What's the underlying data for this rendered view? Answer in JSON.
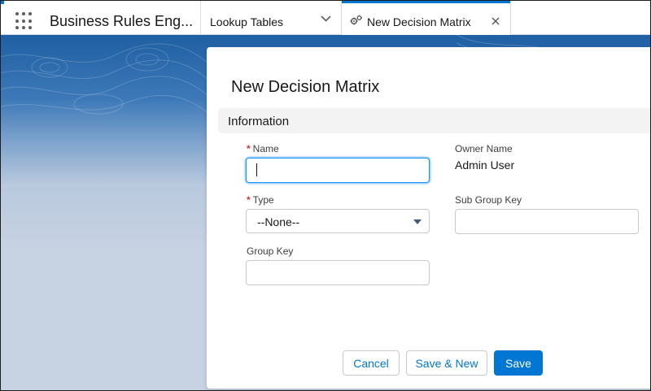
{
  "nav": {
    "app_name": "Business Rules Eng...",
    "tabs": [
      {
        "label": "Lookup Tables",
        "active": false
      },
      {
        "label": "New Decision Matrix",
        "active": true
      }
    ]
  },
  "modal": {
    "title": "New Decision Matrix",
    "section": "Information",
    "fields": {
      "name": {
        "label": "Name",
        "required_marker": "*",
        "value": ""
      },
      "type": {
        "label": "Type",
        "required_marker": "*",
        "selected": "--None--"
      },
      "group_key": {
        "label": "Group Key",
        "value": ""
      },
      "owner_name": {
        "label": "Owner Name",
        "value": "Admin User"
      },
      "sub_group_key": {
        "label": "Sub Group Key",
        "value": ""
      }
    },
    "buttons": {
      "cancel": "Cancel",
      "save_new": "Save & New",
      "save": "Save"
    }
  },
  "colors": {
    "brand": "#0176d3",
    "required": "#c23934",
    "focus": "#1b96ff"
  },
  "icons": {
    "app_launcher": "waffle-grid-icon",
    "tab_type": "gears-icon",
    "tab_close": "close-icon",
    "tab_menu": "chevron-down-icon",
    "select_arrow": "caret-down-icon"
  }
}
